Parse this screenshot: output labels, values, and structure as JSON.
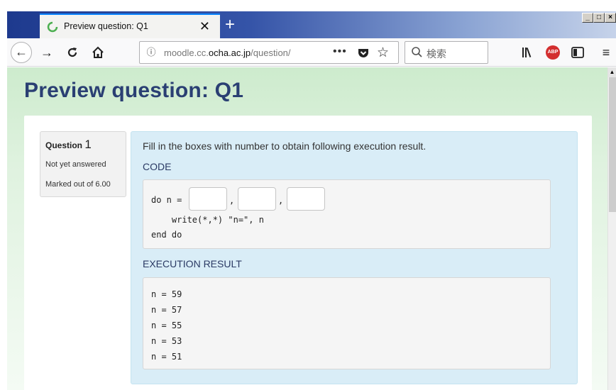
{
  "browser": {
    "tab_title": "Preview question: Q1",
    "tab_close": "✕",
    "new_tab": "+",
    "window_controls": [
      "_",
      "□",
      "×"
    ],
    "url_prefix": "moodle.cc.",
    "url_domain": "ocha.ac.jp",
    "url_suffix": "/question/",
    "url_more": "•••",
    "search_placeholder": "検索",
    "abp_label": "ABP"
  },
  "page": {
    "title": "Preview question: Q1"
  },
  "question": {
    "label": "Question",
    "number": "1",
    "state": "Not yet answered",
    "grade": "Marked out of 6.00",
    "text": "Fill in the boxes with number to obtain following execution result.",
    "code_heading": "CODE",
    "code": {
      "line1_prefix": "do n = ",
      "comma": ",",
      "line2": "    write(*,*) \"n=\", n",
      "line3": "end do"
    },
    "execution_heading": "EXECUTION RESULT",
    "execution_lines": [
      "n = 59",
      "n = 57",
      "n = 55",
      "n = 53",
      "n = 51"
    ]
  },
  "colors": {
    "accent_blue": "#0a84ff",
    "title_navy": "#2a3f73",
    "formulation_bg": "#d9edf7",
    "page_gradient_top": "#cdebcd"
  }
}
